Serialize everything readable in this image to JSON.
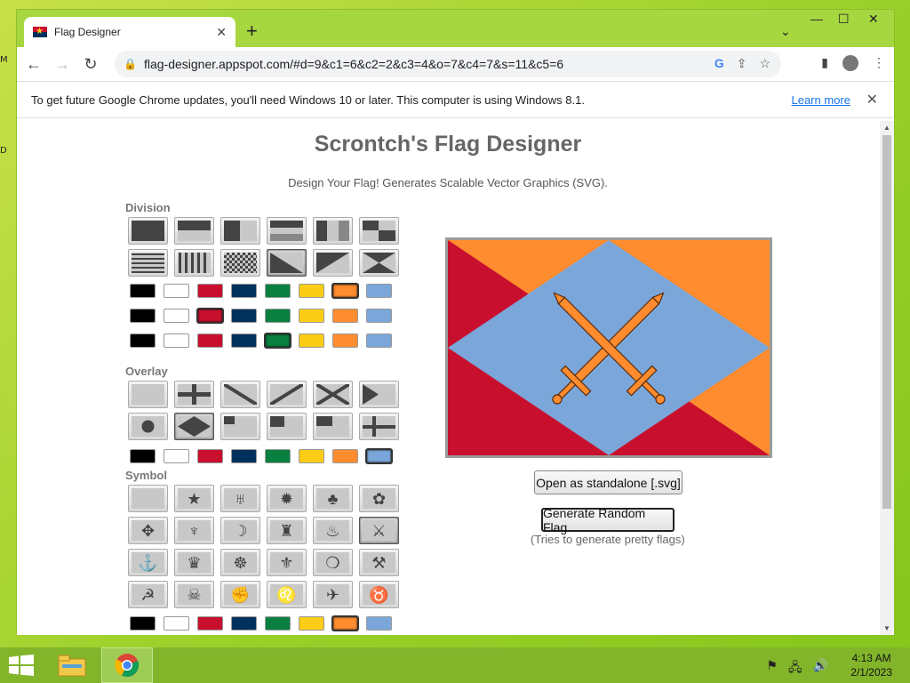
{
  "desktop": {
    "edge_labels": [
      "M",
      "D"
    ]
  },
  "window": {
    "tab_title": "Flag Designer",
    "tab_close": "✕",
    "new_tab": "+",
    "controls": {
      "chevron": "⌄",
      "minimize": "—",
      "maximize": "☐",
      "close": "✕"
    }
  },
  "toolbar": {
    "back": "←",
    "forward": "→",
    "reload": "↻",
    "url": "flag-designer.appspot.com/#d=9&c1=6&c2=2&c3=4&o=7&c4=7&s=11&c5=6",
    "icons": [
      "google-icon",
      "share-icon",
      "bookmark-star-icon",
      "side-panel-icon",
      "profile-icon",
      "menu-icon"
    ]
  },
  "infobar": {
    "message": "To get future Google Chrome updates, you'll need Windows 10 or later. This computer is using Windows 8.1.",
    "link": "Learn more",
    "close": "✕"
  },
  "page": {
    "title": "Scrontch's Flag Designer",
    "subtitle": "Design Your Flag! Generates Scalable Vector Graphics (SVG).",
    "sections": {
      "division": "Division",
      "overlay": "Overlay",
      "symbol": "Symbol"
    },
    "open_button": "Open as standalone [.svg]",
    "random_button": "Generate Random Flag",
    "random_note": "(Tries to generate pretty flags)"
  },
  "palette": [
    "#000000",
    "#ffffff",
    "#c8102e",
    "#00305c",
    "#098040",
    "#fccd16",
    "#ff8c2f",
    "#7ba6d9"
  ],
  "selection": {
    "division": 9,
    "color1": 6,
    "color2": 2,
    "color3": 4,
    "overlay": 7,
    "color4": 7,
    "symbol": 11,
    "color5": 6
  },
  "flag": {
    "colors": {
      "field_top": "#ff8c2f",
      "field_triangles": "#c8102e",
      "diamond": "#7ba6d9",
      "swords": "#ff8c2f"
    }
  },
  "taskbar": {
    "clock_time": "4:13 AM",
    "clock_date": "2/1/2023"
  }
}
